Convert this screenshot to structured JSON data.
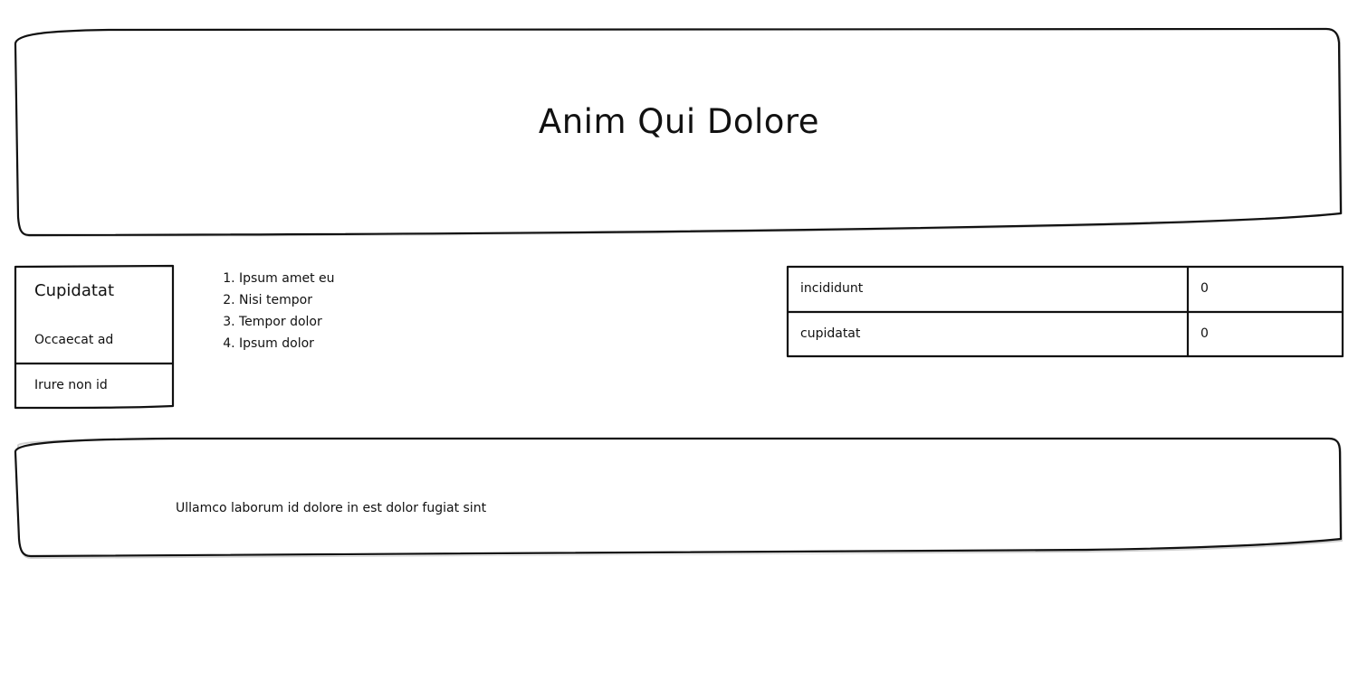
{
  "header": {
    "title": "Anim Qui Dolore"
  },
  "card": {
    "heading": "Cupidatat",
    "subtitle": "Occaecat ad",
    "footer": "Irure non id"
  },
  "list": {
    "items": [
      "Ipsum amet eu",
      "Nisi tempor",
      "Tempor dolor",
      "Ipsum dolor"
    ]
  },
  "table": {
    "rows": [
      {
        "label": "incididunt",
        "value": "0"
      },
      {
        "label": "cupidatat",
        "value": "0"
      }
    ]
  },
  "footer": {
    "text": "Ullamco laborum id dolore in est dolor fugiat sint"
  }
}
